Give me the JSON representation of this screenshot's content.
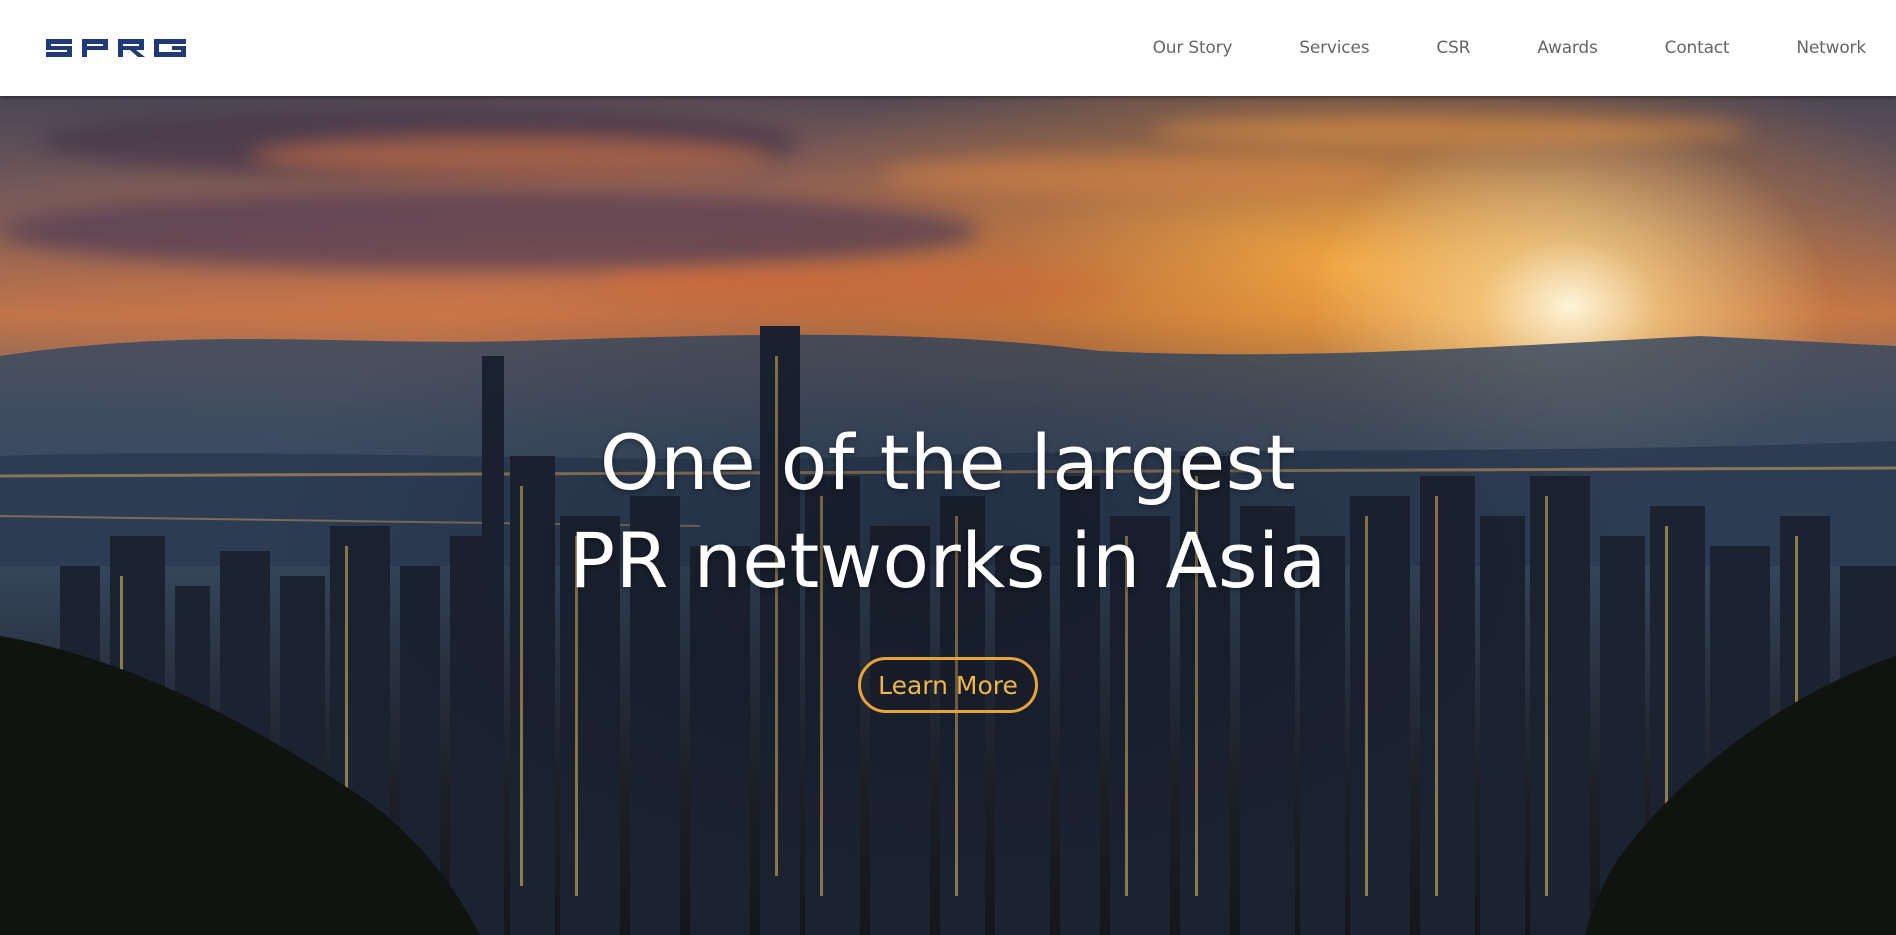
{
  "brand": {
    "logo_text": "SPRG",
    "logo_color": "#1e3a78"
  },
  "nav": {
    "items": [
      {
        "label": "Our Story"
      },
      {
        "label": "Services"
      },
      {
        "label": "CSR"
      },
      {
        "label": "Awards"
      },
      {
        "label": "Contact"
      },
      {
        "label": "Network"
      }
    ]
  },
  "hero": {
    "headline_line1": "One of the largest",
    "headline_line2": "PR networks in Asia",
    "cta_label": "Learn More",
    "cta_color": "#e8a33a",
    "background_description_icon": "city-skyline-sunset-image"
  }
}
